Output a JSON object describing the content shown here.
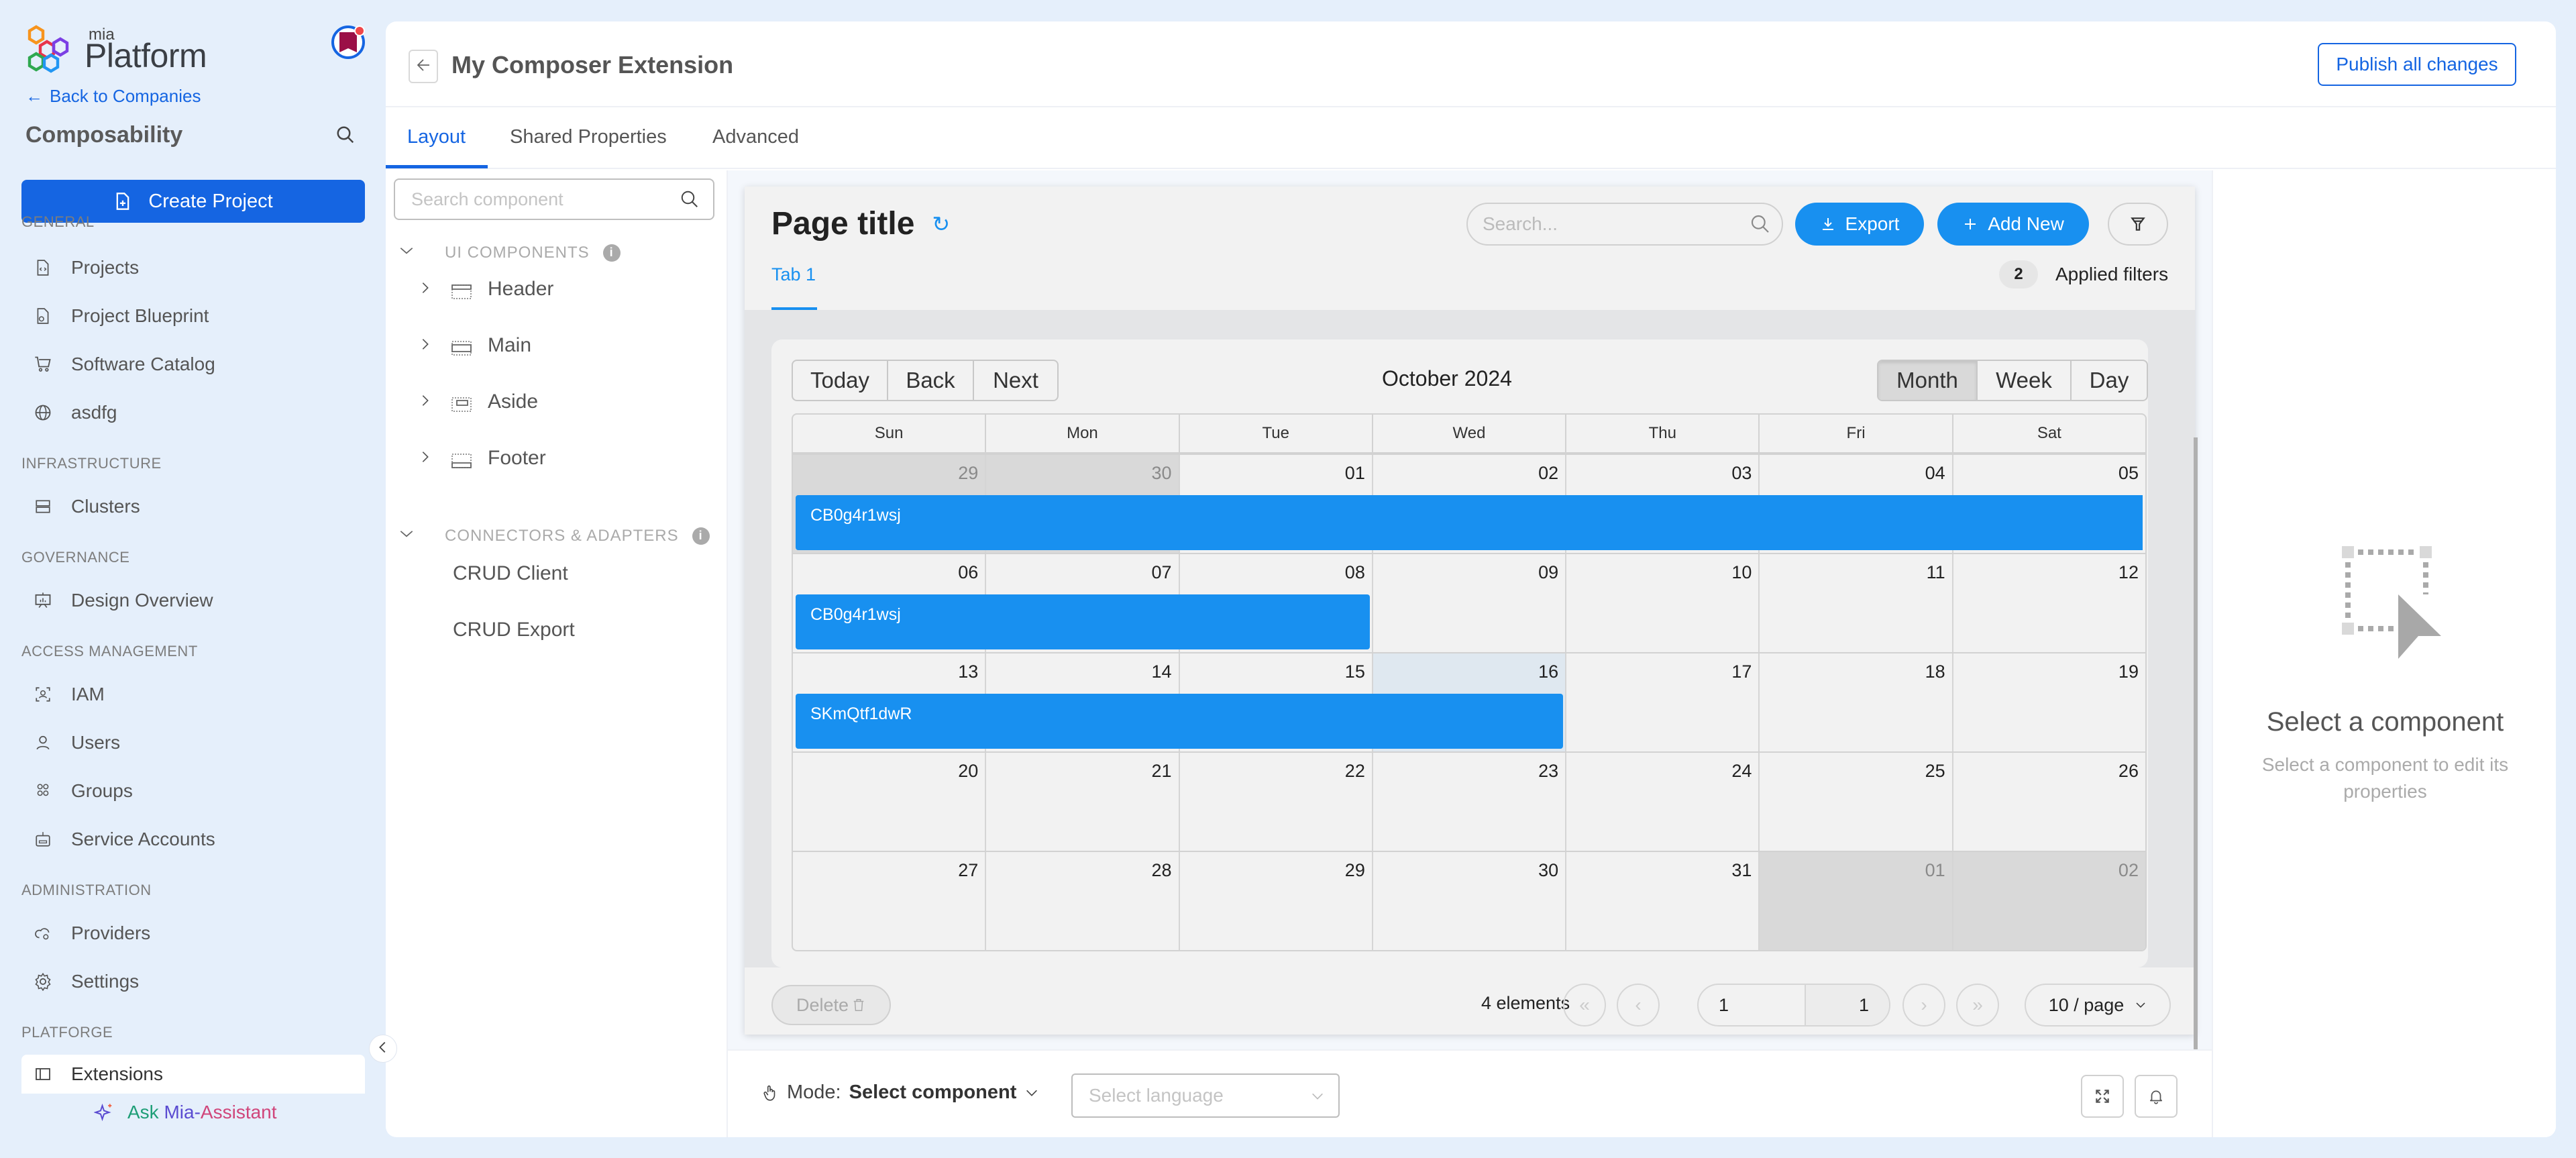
{
  "sidebar": {
    "logo": {
      "small": "mia",
      "big": "Platform"
    },
    "back_link": "Back to Companies",
    "project_name": "Composability",
    "create_button": "Create Project",
    "sections": [
      {
        "label": "GENERAL",
        "items": [
          "Projects",
          "Project Blueprint",
          "Software Catalog",
          "asdfg"
        ]
      },
      {
        "label": "INFRASTRUCTURE",
        "items": [
          "Clusters"
        ]
      },
      {
        "label": "GOVERNANCE",
        "items": [
          "Design Overview"
        ]
      },
      {
        "label": "ACCESS MANAGEMENT",
        "items": [
          "IAM",
          "Users",
          "Groups",
          "Service Accounts"
        ]
      },
      {
        "label": "ADMINISTRATION",
        "items": [
          "Providers",
          "Settings"
        ]
      },
      {
        "label": "PLATFORGE",
        "items": [
          "Extensions"
        ]
      }
    ],
    "active_item": "Extensions",
    "assistant": {
      "ask": "Ask",
      "mia": "Mia-",
      "assistant": "Assistant"
    }
  },
  "header": {
    "title": "My Composer Extension",
    "publish_button": "Publish all changes"
  },
  "tabs": [
    {
      "label": "Layout",
      "active": true
    },
    {
      "label": "Shared Properties",
      "active": false
    },
    {
      "label": "Advanced",
      "active": false
    }
  ],
  "component_tree": {
    "search_placeholder": "Search component",
    "sections": [
      {
        "label": "UI COMPONENTS",
        "items": [
          "Header",
          "Main",
          "Aside",
          "Footer"
        ]
      },
      {
        "label": "CONNECTORS & ADAPTERS",
        "items": [
          "CRUD Client",
          "CRUD Export"
        ]
      }
    ]
  },
  "preview": {
    "page_title": "Page title",
    "search_placeholder": "Search...",
    "export_button": "Export",
    "add_new_button": "Add New",
    "applied_filters_count": "2",
    "applied_filters_label": "Applied filters",
    "tab": "Tab 1",
    "calendar": {
      "nav_buttons": [
        "Today",
        "Back",
        "Next"
      ],
      "label": "October 2024",
      "views": [
        "Month",
        "Week",
        "Day"
      ],
      "active_view": "Month",
      "weekdays": [
        "Sun",
        "Mon",
        "Tue",
        "Wed",
        "Thu",
        "Fri",
        "Sat"
      ],
      "weeks": [
        [
          {
            "d": "29",
            "off": true
          },
          {
            "d": "30",
            "off": true
          },
          {
            "d": "01"
          },
          {
            "d": "02"
          },
          {
            "d": "03"
          },
          {
            "d": "04"
          },
          {
            "d": "05"
          }
        ],
        [
          {
            "d": "06"
          },
          {
            "d": "07"
          },
          {
            "d": "08"
          },
          {
            "d": "09"
          },
          {
            "d": "10"
          },
          {
            "d": "11"
          },
          {
            "d": "12"
          }
        ],
        [
          {
            "d": "13"
          },
          {
            "d": "14"
          },
          {
            "d": "15"
          },
          {
            "d": "16",
            "today": true
          },
          {
            "d": "17"
          },
          {
            "d": "18"
          },
          {
            "d": "19"
          }
        ],
        [
          {
            "d": "20"
          },
          {
            "d": "21"
          },
          {
            "d": "22"
          },
          {
            "d": "23"
          },
          {
            "d": "24"
          },
          {
            "d": "25"
          },
          {
            "d": "26"
          }
        ],
        [
          {
            "d": "27"
          },
          {
            "d": "28"
          },
          {
            "d": "29"
          },
          {
            "d": "30"
          },
          {
            "d": "31"
          },
          {
            "d": "01",
            "off": true
          },
          {
            "d": "02",
            "off": true
          }
        ]
      ],
      "events": [
        {
          "title": "CB0g4r1wsj",
          "week": 0,
          "start_col": 0,
          "span": 7
        },
        {
          "title": "CB0g4r1wsj",
          "week": 1,
          "start_col": 0,
          "span": 3
        },
        {
          "title": "SKmQtf1dwR",
          "week": 2,
          "start_col": 0,
          "span": 4
        }
      ]
    },
    "footer": {
      "delete_button": "Delete",
      "elements": "4 elements",
      "page_current": "1",
      "page_total": "1",
      "per_page": "10 / page"
    }
  },
  "bottom_bar": {
    "mode_label": "Mode:",
    "mode_value": "Select component",
    "language_placeholder": "Select language"
  },
  "properties_panel": {
    "title": "Select a component",
    "description": "Select a component to edit its properties"
  },
  "colors": {
    "brand": "#1565e2",
    "preview_accent": "#1890f0",
    "sidebar_bg": "#e5effb"
  }
}
